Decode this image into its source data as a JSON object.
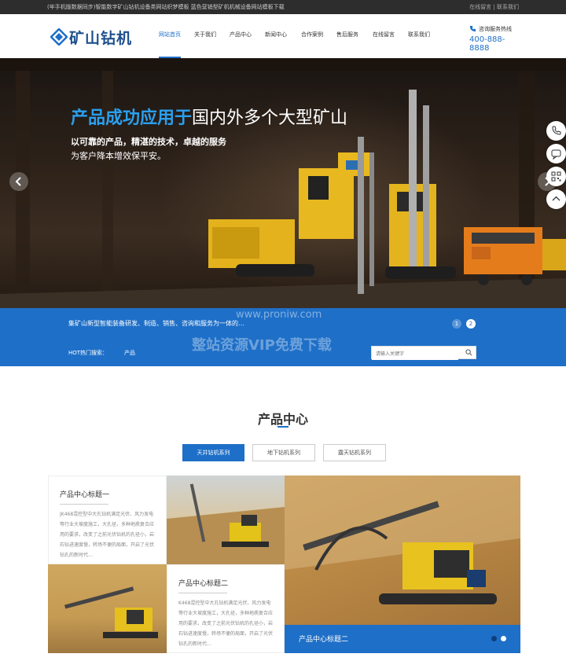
{
  "topbar": {
    "left_text": "(牢手机版数据同步)智能数字矿山钻机设备类网站织梦模板 蓝色营销型矿机机械设备网站模板下载",
    "right_text": "在线留言 | 联系我们"
  },
  "logo": {
    "text": "矿山钻机"
  },
  "nav": {
    "items": [
      {
        "label": "网站首页",
        "active": true
      },
      {
        "label": "关于我们"
      },
      {
        "label": "产品中心"
      },
      {
        "label": "新闻中心"
      },
      {
        "label": "合作案例"
      },
      {
        "label": "售后服务"
      },
      {
        "label": "在线留言"
      },
      {
        "label": "联系我们"
      }
    ]
  },
  "hotline": {
    "label": "咨询服务热线",
    "number": "400-888-8888"
  },
  "banner": {
    "headline_highlight": "产品成功应用于",
    "headline_rest": "国内外多个大型矿山",
    "sub1": "以可靠的产品，精湛的技术，卓越的服务",
    "sub2": "为客户降本增效保平安。"
  },
  "strip": {
    "slogan": "集矿山新型智能装备研发、制造、销售、咨询和服务为一体的…",
    "pages": [
      "1",
      "2"
    ],
    "hot_label": "HOT热门搜索：",
    "hot_keyword": "产品",
    "search_placeholder": "请输入关键字"
  },
  "products": {
    "title": "产品中心",
    "tabs": [
      "天井钻机系列",
      "地下钻机系列",
      "露天钻机系列"
    ],
    "card1": {
      "title": "产品中心标题一",
      "text": "JK468混控型中大孔钻机满足光伏、风力发电等行业大坡度施工，大孔径，多种地质复合应用的要求，改变了之前光伏钻机的孔径小，岩石钻进速度慢，转场不便的局面，开启了光伏钻孔的新时代…"
    },
    "card2": {
      "title": "产品中心标题二",
      "text": "K468混控型中大孔钻机满足光伏、风力发电等行业大坡度施工，大孔径，多种地质复合应用的要求，改变了之前光伏钻机的孔径小，岩石钻进速度慢，转场不便的局面，开启了光伏钻孔的新时代…"
    },
    "big_caption": "产品中心标题二"
  },
  "watermark": {
    "url": "www.proniw.com",
    "text": "整站资源VIP免费下载"
  },
  "colors": {
    "brand": "#1e6fc8",
    "dark": "#2d2d2d",
    "highlight": "#2aa0ef"
  },
  "side_tools": [
    "phone-icon",
    "chat-icon",
    "qrcode-icon",
    "back-to-top-icon"
  ]
}
